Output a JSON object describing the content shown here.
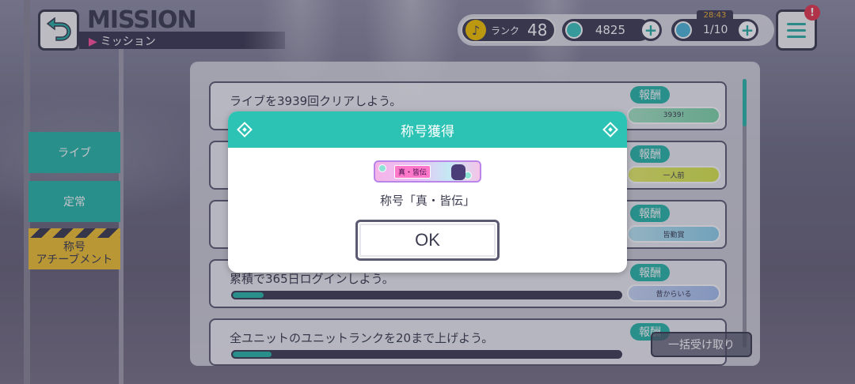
{
  "header": {
    "title": "MISSION",
    "subtitle": "ミッション",
    "back_icon": "back-arrow-icon"
  },
  "status": {
    "rank_label": "ランク",
    "rank_value": "48",
    "gems": "4825",
    "energy": "1/10",
    "timer": "28:43",
    "notification": "!"
  },
  "sidebar": {
    "items": [
      {
        "label": "ライブ"
      },
      {
        "label": "定常"
      },
      {
        "label": "称号\nアチーブメント"
      }
    ]
  },
  "missions": [
    {
      "text": "ライブを3939回クリアしよう。",
      "reward_label": "報酬",
      "reward": "3939!",
      "progress": null
    },
    {
      "text": "",
      "reward_label": "報酬",
      "reward": "一人前",
      "progress": null
    },
    {
      "text": "",
      "reward_label": "報酬",
      "reward": "皆勤賞",
      "progress": null
    },
    {
      "text": "累積で365日ログインしよう。",
      "reward_label": "報酬",
      "reward": "昔からいる",
      "progress": 0.08
    },
    {
      "text": "全ユニットのユニットランクを20まで上げよう。",
      "reward_label": "報酬",
      "reward": "",
      "progress": 0.1
    }
  ],
  "bulk_button": "一括受け取り",
  "modal": {
    "header": "称号獲得",
    "plate_tag": "真・皆伝",
    "name": "称号「真・皆伝」",
    "ok_label": "OK"
  },
  "colors": {
    "accent": "#2cc2b4",
    "dark": "#3c3c50",
    "yellow": "#f3c333"
  }
}
